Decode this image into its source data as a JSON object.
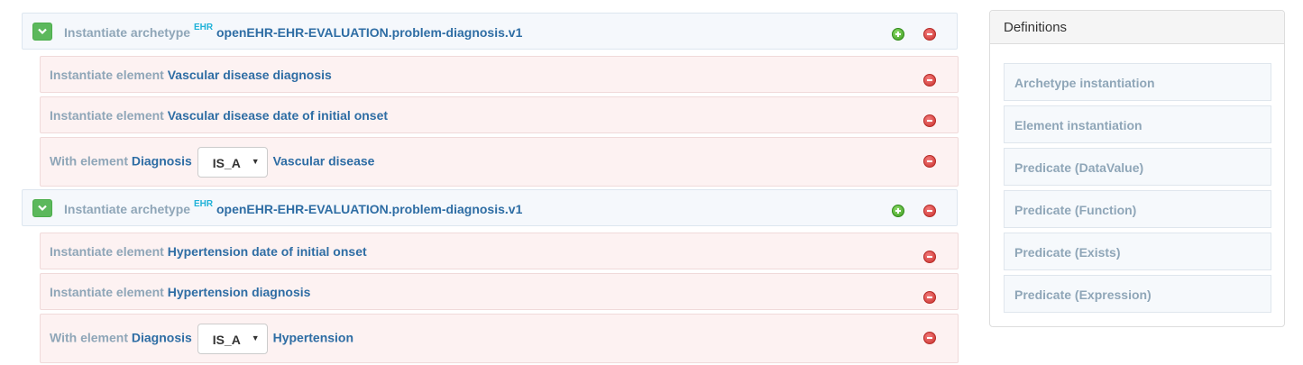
{
  "archetypes": [
    {
      "prefix": "Instantiate archetype",
      "badge": "EHR",
      "name": "openEHR-EHR-EVALUATION.problem-diagnosis.v1",
      "elements": [
        {
          "prefix": "Instantiate element",
          "name": "Vascular disease diagnosis"
        },
        {
          "prefix": "Instantiate element",
          "name": "Vascular disease date of initial onset"
        }
      ],
      "predicate": {
        "prefix": "With element",
        "element": "Diagnosis",
        "operator": "IS_A",
        "value": "Vascular disease"
      }
    },
    {
      "prefix": "Instantiate archetype",
      "badge": "EHR",
      "name": "openEHR-EHR-EVALUATION.problem-diagnosis.v1",
      "elements": [
        {
          "prefix": "Instantiate element",
          "name": "Hypertension date of initial onset"
        },
        {
          "prefix": "Instantiate element",
          "name": "Hypertension diagnosis"
        }
      ],
      "predicate": {
        "prefix": "With element",
        "element": "Diagnosis",
        "operator": "IS_A",
        "value": "Hypertension"
      }
    }
  ],
  "definitions": {
    "title": "Definitions",
    "items": [
      "Archetype instantiation",
      "Element instantiation",
      "Predicate (DataValue)",
      "Predicate (Function)",
      "Predicate (Exists)",
      "Predicate (Expression)"
    ]
  },
  "colors": {
    "toggle": "#5cb85c",
    "add": "#3c9b1f",
    "remove": "#c9302c",
    "archetype_bg": "#f5f8fc",
    "element_bg": "#fdf2f2",
    "link": "#2e6da4",
    "muted": "#8fa6b8",
    "badge": "#1fb2d8"
  },
  "icons": {
    "toggle": "chevron-down-icon",
    "add": "plus-circle-icon",
    "remove": "minus-circle-icon"
  }
}
